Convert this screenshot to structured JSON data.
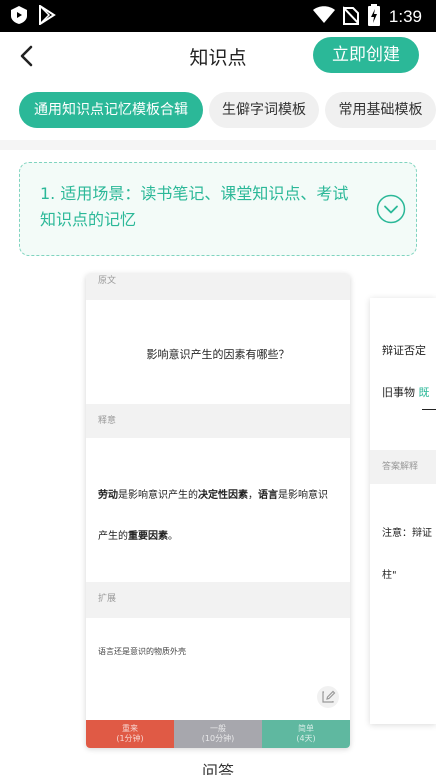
{
  "status_bar": {
    "time": "1:39"
  },
  "header": {
    "title": "知识点",
    "create_label": "立即创建"
  },
  "tabs": [
    {
      "label": "通用知识点记忆模板合辑",
      "active": true
    },
    {
      "label": "生僻字词模板",
      "active": false
    },
    {
      "label": "常用基础模板",
      "active": false
    }
  ],
  "scene": {
    "text": "1. 适用场景：读书笔记、课堂知识点、考试知识点的记忆"
  },
  "card": {
    "section_original": "原文",
    "question": "影响意识产生的因素有哪些？",
    "section_explain": "释意",
    "answer_part1": "劳动",
    "answer_part2": "是影响意识产生的",
    "answer_part3": "决定性因素",
    "answer_part4": "，",
    "answer_part5": "语言",
    "answer_part6": "是影响意识",
    "answer_part7": "产生的",
    "answer_part8": "重要因素",
    "answer_part9": "。",
    "section_extend": "扩展",
    "extend_text": "语言还是意识的物质外壳",
    "buttons": [
      {
        "title": "重来",
        "sub": "(1分钟)",
        "color": "#e05a45"
      },
      {
        "title": "一般",
        "sub": "(10分钟)",
        "color": "#a7a7ad"
      },
      {
        "title": "简单",
        "sub": "(4天)",
        "color": "#5fb8a0"
      }
    ]
  },
  "card2": {
    "line1": "辩证否定",
    "line2_a": "旧事物",
    "line2_b": "既",
    "section": "答案解释",
    "line3": "注意：辩证",
    "line4": "柱\""
  },
  "caption": "问答"
}
